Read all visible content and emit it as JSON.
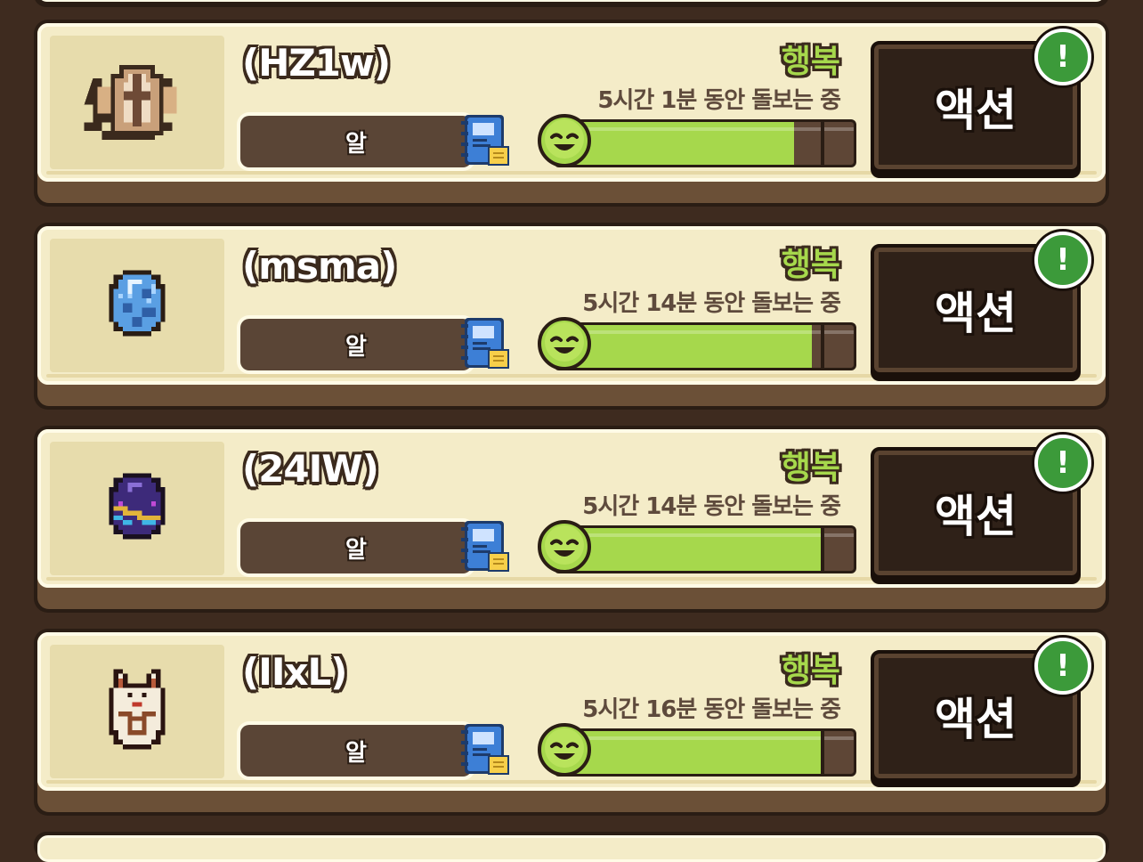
{
  "pets": [
    {
      "name": "(HZ1w)",
      "stage": "알",
      "mood": "행복",
      "care_time": "5시간 1분 동안 돌보는 중",
      "happiness": 0.8,
      "action_label": "액션",
      "alert_mark": "!",
      "portrait_icon": "crest-egg-icon"
    },
    {
      "name": "(msma)",
      "stage": "알",
      "mood": "행복",
      "care_time": "5시간 14분 동안 돌보는 중",
      "happiness": 0.86,
      "action_label": "액션",
      "alert_mark": "!",
      "portrait_icon": "blue-egg-icon"
    },
    {
      "name": "(24IW)",
      "stage": "알",
      "mood": "행복",
      "care_time": "5시간 14분 동안 돌보는 중",
      "happiness": 0.89,
      "action_label": "액션",
      "alert_mark": "!",
      "portrait_icon": "purple-egg-icon"
    },
    {
      "name": "(IIxL)",
      "stage": "알",
      "mood": "행복",
      "care_time": "5시간 16분 동안 돌보는 중",
      "happiness": 0.9,
      "action_label": "액션",
      "alert_mark": "!",
      "portrait_icon": "horned-egg-icon"
    }
  ],
  "colors": {
    "happy_green": "#a6d84c",
    "panel": "#f4ecc8",
    "frame": "#2a1d14",
    "alert_green": "#3c9a3a"
  }
}
